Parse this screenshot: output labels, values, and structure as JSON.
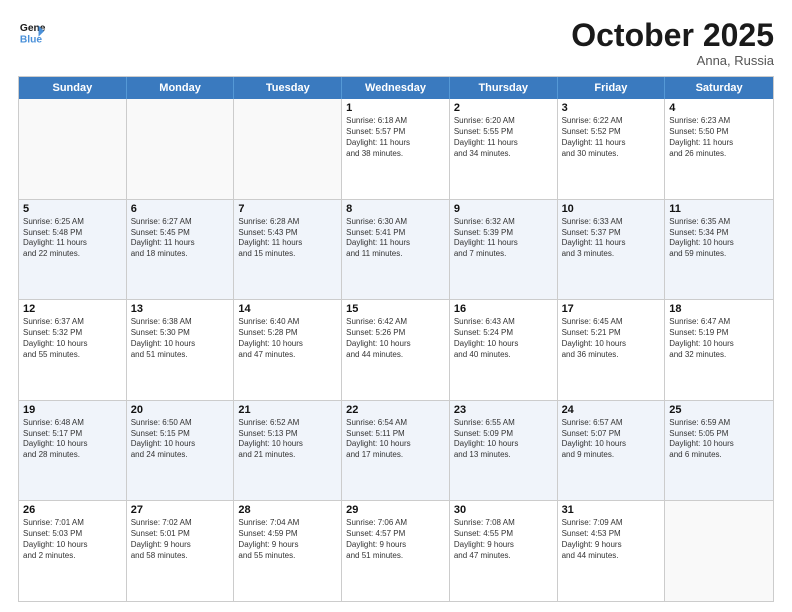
{
  "header": {
    "logo_line1": "General",
    "logo_line2": "Blue",
    "month": "October 2025",
    "location": "Anna, Russia"
  },
  "days_of_week": [
    "Sunday",
    "Monday",
    "Tuesday",
    "Wednesday",
    "Thursday",
    "Friday",
    "Saturday"
  ],
  "rows": [
    [
      {
        "day": "",
        "text": ""
      },
      {
        "day": "",
        "text": ""
      },
      {
        "day": "",
        "text": ""
      },
      {
        "day": "1",
        "text": "Sunrise: 6:18 AM\nSunset: 5:57 PM\nDaylight: 11 hours\nand 38 minutes."
      },
      {
        "day": "2",
        "text": "Sunrise: 6:20 AM\nSunset: 5:55 PM\nDaylight: 11 hours\nand 34 minutes."
      },
      {
        "day": "3",
        "text": "Sunrise: 6:22 AM\nSunset: 5:52 PM\nDaylight: 11 hours\nand 30 minutes."
      },
      {
        "day": "4",
        "text": "Sunrise: 6:23 AM\nSunset: 5:50 PM\nDaylight: 11 hours\nand 26 minutes."
      }
    ],
    [
      {
        "day": "5",
        "text": "Sunrise: 6:25 AM\nSunset: 5:48 PM\nDaylight: 11 hours\nand 22 minutes."
      },
      {
        "day": "6",
        "text": "Sunrise: 6:27 AM\nSunset: 5:45 PM\nDaylight: 11 hours\nand 18 minutes."
      },
      {
        "day": "7",
        "text": "Sunrise: 6:28 AM\nSunset: 5:43 PM\nDaylight: 11 hours\nand 15 minutes."
      },
      {
        "day": "8",
        "text": "Sunrise: 6:30 AM\nSunset: 5:41 PM\nDaylight: 11 hours\nand 11 minutes."
      },
      {
        "day": "9",
        "text": "Sunrise: 6:32 AM\nSunset: 5:39 PM\nDaylight: 11 hours\nand 7 minutes."
      },
      {
        "day": "10",
        "text": "Sunrise: 6:33 AM\nSunset: 5:37 PM\nDaylight: 11 hours\nand 3 minutes."
      },
      {
        "day": "11",
        "text": "Sunrise: 6:35 AM\nSunset: 5:34 PM\nDaylight: 10 hours\nand 59 minutes."
      }
    ],
    [
      {
        "day": "12",
        "text": "Sunrise: 6:37 AM\nSunset: 5:32 PM\nDaylight: 10 hours\nand 55 minutes."
      },
      {
        "day": "13",
        "text": "Sunrise: 6:38 AM\nSunset: 5:30 PM\nDaylight: 10 hours\nand 51 minutes."
      },
      {
        "day": "14",
        "text": "Sunrise: 6:40 AM\nSunset: 5:28 PM\nDaylight: 10 hours\nand 47 minutes."
      },
      {
        "day": "15",
        "text": "Sunrise: 6:42 AM\nSunset: 5:26 PM\nDaylight: 10 hours\nand 44 minutes."
      },
      {
        "day": "16",
        "text": "Sunrise: 6:43 AM\nSunset: 5:24 PM\nDaylight: 10 hours\nand 40 minutes."
      },
      {
        "day": "17",
        "text": "Sunrise: 6:45 AM\nSunset: 5:21 PM\nDaylight: 10 hours\nand 36 minutes."
      },
      {
        "day": "18",
        "text": "Sunrise: 6:47 AM\nSunset: 5:19 PM\nDaylight: 10 hours\nand 32 minutes."
      }
    ],
    [
      {
        "day": "19",
        "text": "Sunrise: 6:48 AM\nSunset: 5:17 PM\nDaylight: 10 hours\nand 28 minutes."
      },
      {
        "day": "20",
        "text": "Sunrise: 6:50 AM\nSunset: 5:15 PM\nDaylight: 10 hours\nand 24 minutes."
      },
      {
        "day": "21",
        "text": "Sunrise: 6:52 AM\nSunset: 5:13 PM\nDaylight: 10 hours\nand 21 minutes."
      },
      {
        "day": "22",
        "text": "Sunrise: 6:54 AM\nSunset: 5:11 PM\nDaylight: 10 hours\nand 17 minutes."
      },
      {
        "day": "23",
        "text": "Sunrise: 6:55 AM\nSunset: 5:09 PM\nDaylight: 10 hours\nand 13 minutes."
      },
      {
        "day": "24",
        "text": "Sunrise: 6:57 AM\nSunset: 5:07 PM\nDaylight: 10 hours\nand 9 minutes."
      },
      {
        "day": "25",
        "text": "Sunrise: 6:59 AM\nSunset: 5:05 PM\nDaylight: 10 hours\nand 6 minutes."
      }
    ],
    [
      {
        "day": "26",
        "text": "Sunrise: 7:01 AM\nSunset: 5:03 PM\nDaylight: 10 hours\nand 2 minutes."
      },
      {
        "day": "27",
        "text": "Sunrise: 7:02 AM\nSunset: 5:01 PM\nDaylight: 9 hours\nand 58 minutes."
      },
      {
        "day": "28",
        "text": "Sunrise: 7:04 AM\nSunset: 4:59 PM\nDaylight: 9 hours\nand 55 minutes."
      },
      {
        "day": "29",
        "text": "Sunrise: 7:06 AM\nSunset: 4:57 PM\nDaylight: 9 hours\nand 51 minutes."
      },
      {
        "day": "30",
        "text": "Sunrise: 7:08 AM\nSunset: 4:55 PM\nDaylight: 9 hours\nand 47 minutes."
      },
      {
        "day": "31",
        "text": "Sunrise: 7:09 AM\nSunset: 4:53 PM\nDaylight: 9 hours\nand 44 minutes."
      },
      {
        "day": "",
        "text": ""
      }
    ]
  ]
}
